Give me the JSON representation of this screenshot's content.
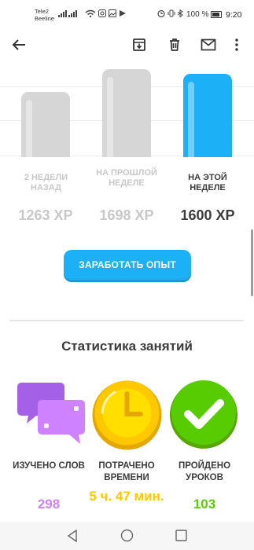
{
  "status_bar": {
    "carrier1": "Tele2",
    "carrier2": "Beeline",
    "battery": "100 %",
    "time": "9:20"
  },
  "toolbar": {
    "icons": [
      "back-arrow-icon",
      "archive-icon",
      "delete-icon",
      "mail-icon",
      "more-vert-icon"
    ]
  },
  "weekly_chart": {
    "bars": [
      {
        "label": "2 НЕДЕЛИ НАЗАД",
        "xp": "1263 XP",
        "value": 1263,
        "current": false
      },
      {
        "label": "НА ПРОШЛОЙ НЕДЕЛЕ",
        "xp": "1698 XP",
        "value": 1698,
        "current": false
      },
      {
        "label": "НА ЭТОЙ НЕДЕЛЕ",
        "xp": "1600 XP",
        "value": 1600,
        "current": true
      }
    ]
  },
  "earn_button": "ЗАРАБОТАТЬ ОПЫТ",
  "stats": {
    "title": "Статистика занятий",
    "items": [
      {
        "label": "ИЗУЧЕНО СЛОВ",
        "value": "298",
        "color": "#ce82ff",
        "icon": "chat-bubbles-icon"
      },
      {
        "label": "ПОТРАЧЕНО ВРЕМЕНИ",
        "value": "5 ч. 47 мин.",
        "color": "#ffc800",
        "icon": "clock-icon"
      },
      {
        "label": "ПРОЙДЕНО УРОКОВ",
        "value": "103",
        "color": "#58cc02",
        "icon": "checkmark-icon"
      }
    ]
  },
  "colors": {
    "accent_blue": "#1cb0f6",
    "inactive_bar": "#d6d6d6"
  },
  "nav_icons": [
    "nav-back-icon",
    "nav-home-icon",
    "nav-recents-icon"
  ]
}
